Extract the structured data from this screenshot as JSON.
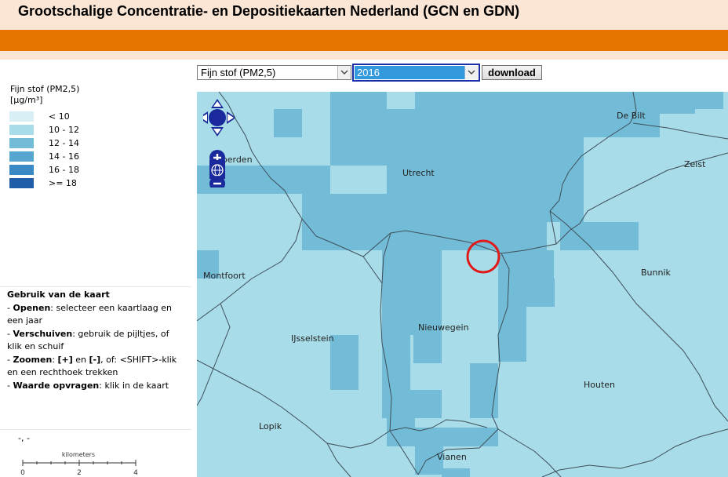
{
  "header": {
    "title": "Grootschalige Concentratie- en Depositiekaarten Nederland (GCN en GDN)"
  },
  "toolbar": {
    "layer_select_value": "Fijn stof (PM2,5)",
    "year_select_value": "2016",
    "download_label": "download"
  },
  "legend": {
    "title_line1": "Fijn stof (PM2,5)",
    "title_line2": "[µg/m³]",
    "items": [
      {
        "label": "< 10",
        "color": "#d7eff5"
      },
      {
        "label": "10 - 12",
        "color": "#a7dce8"
      },
      {
        "label": "12 - 14",
        "color": "#73bcd8"
      },
      {
        "label": "14 - 16",
        "color": "#56a6d0"
      },
      {
        "label": "16 - 18",
        "color": "#3b89c4"
      },
      {
        "label": ">= 18",
        "color": "#1f5da8"
      }
    ]
  },
  "usage": {
    "heading": "Gebruik van de kaart",
    "line1_bold": "Openen",
    "line1_text": ": selecteer een kaartlaag en een jaar",
    "line2_bold": "Verschuiven",
    "line2_text": ": gebruik de pijltjes, of klik en schuif",
    "line3_bold": "Zoomen",
    "line3_mid1": ": ",
    "line3_plus": "[+]",
    "line3_mid2": " en ",
    "line3_minus": "[-]",
    "line3_text": ", of: <SHIFT>-klik en een rechthoek trekken",
    "line4_bold": "Waarde opvragen",
    "line4_text": ": klik in de kaart"
  },
  "coordinates": "-, -",
  "scale": {
    "unit": "kilometers",
    "ticks": [
      "0",
      "2",
      "4"
    ]
  },
  "map": {
    "places": [
      {
        "id": "de-bilt",
        "name": "De Bilt"
      },
      {
        "id": "woerden",
        "name": "oerden"
      },
      {
        "id": "utrecht",
        "name": "Utrecht"
      },
      {
        "id": "zeist",
        "name": "Zeist"
      },
      {
        "id": "montfoort",
        "name": "Montfoort"
      },
      {
        "id": "bunnik",
        "name": "Bunnik"
      },
      {
        "id": "nieuwegein",
        "name": "Nieuwegein"
      },
      {
        "id": "ijsselstein",
        "name": "IJsselstein"
      },
      {
        "id": "houten",
        "name": "Houten"
      },
      {
        "id": "lopik",
        "name": "Lopik"
      },
      {
        "id": "vianen",
        "name": "Vianen"
      }
    ]
  }
}
